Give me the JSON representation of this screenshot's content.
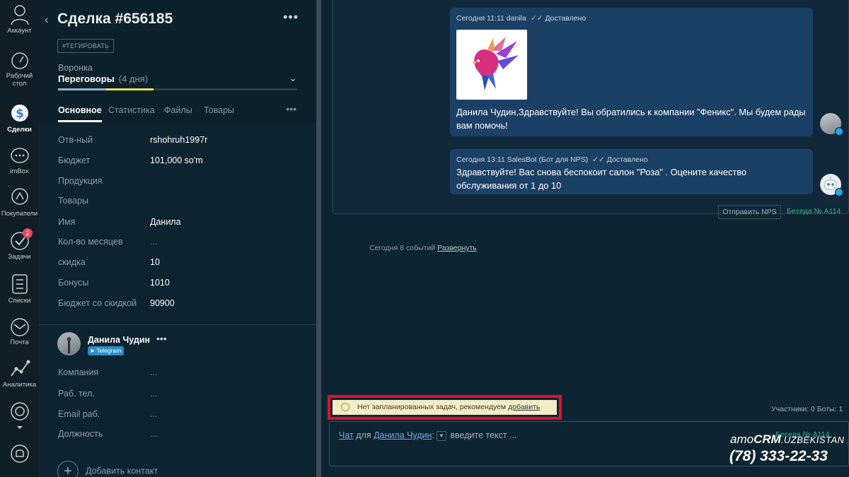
{
  "nav": {
    "account": "Аккаунт",
    "dashboard": "Рабочий стол",
    "deals": "Сделки",
    "imbox": "imBox",
    "customers": "Покупатели",
    "tasks": "Задачи",
    "tasks_badge": "2",
    "lists": "Списки",
    "mail": "Почта",
    "analytics": "Аналитика"
  },
  "deal": {
    "title": "Сделка #656185",
    "tag_button": "#ТЕГИРОВАТЬ",
    "funnel_label": "Воронка",
    "funnel_stage": "Переговоры",
    "funnel_days": "(4 дня)",
    "tabs": [
      "Основное",
      "Статистика",
      "Файлы",
      "Товары"
    ]
  },
  "fields": [
    {
      "label": "Отв-ный",
      "value": "rshohruh1997r"
    },
    {
      "label": "Бюджет",
      "value": "101,000 so'm"
    },
    {
      "label": "Продукция",
      "value": ""
    },
    {
      "label": "Товары",
      "value": ""
    },
    {
      "label": "Имя",
      "value": "Данила"
    },
    {
      "label": "Кол-во месяцев",
      "value": "..."
    },
    {
      "label": "скидка",
      "value": "10"
    },
    {
      "label": "Бонусы",
      "value": "1010"
    },
    {
      "label": "Бюджет со скидкой",
      "value": "90900"
    }
  ],
  "contact": {
    "name": "Данила Чудин",
    "channel": "Telegram",
    "fields": [
      {
        "label": "Компания",
        "value": "..."
      },
      {
        "label": "Раб. тел.",
        "value": "..."
      },
      {
        "label": "Email раб.",
        "value": "..."
      },
      {
        "label": "Должность",
        "value": "..."
      }
    ],
    "add_label": "Добавить контакт"
  },
  "messages": [
    {
      "header": "Сегодня 11:11 danila",
      "status": "Доставлено",
      "text": "Данила Чудин,Здравствуйте! Вы обратились к компании \"Феникс\". Мы будем рады вам помочь!"
    },
    {
      "header": "Сегодня 13:11 SalesBot (Бот для NPS)",
      "status": "Доставлено",
      "text": "Здравствуйте! Вас снова беспокоит салон \"Роза\" . Оцените качество обслуживания от 1 до 10"
    }
  ],
  "conversation": {
    "nps_button": "Отправить NPS",
    "number": "Беседа № A114",
    "events_text": "Сегодня 8 событий",
    "expand_link": "Развернуть"
  },
  "task_notice": {
    "text": "Нет запланированных задач, рекомендуем",
    "link": "добавить"
  },
  "participants": "Участники: 0   Боты: 1",
  "chat": {
    "mode_link": "Чат",
    "for_text": "для",
    "recipient_link": "Данила Чудин",
    "colon": ":",
    "placeholder": "введите текст ...",
    "conversation_number": "Беседа № A114"
  },
  "watermark": {
    "brand_a": "amo",
    "brand_b": "CRM",
    "brand_c": ".UZBEKISTAN",
    "phone": "(78) 333-22-33"
  },
  "colors": {
    "accent_green": "#3bb38a",
    "message_bg": "#1b4066",
    "highlight_red": "#e2102d"
  }
}
